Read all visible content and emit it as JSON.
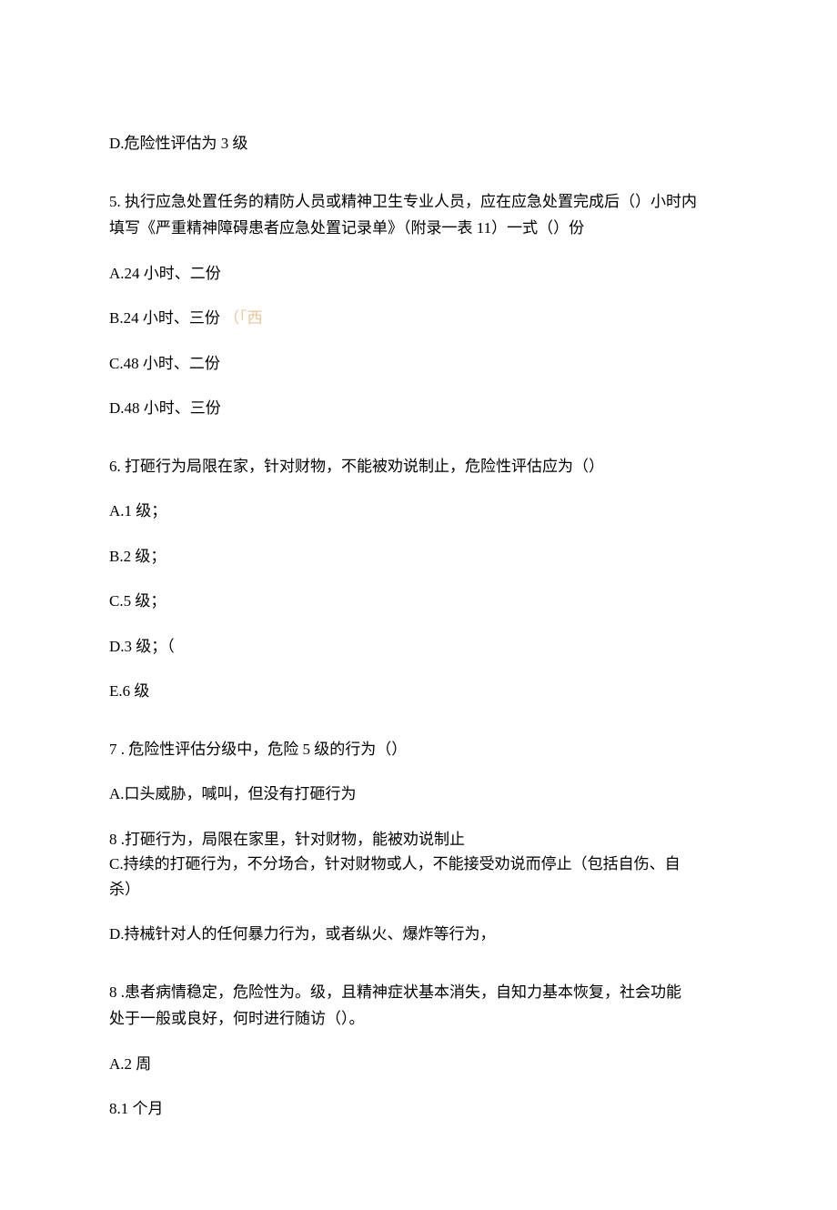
{
  "q4": {
    "D": "D.危险性评估为 3 级"
  },
  "q5": {
    "stem1": "5. 执行应急处置任务的精防人员或精神卫生专业人员，应在应急处置完成后（）小时内",
    "stem2": "填写《严重精神障碍患者应急处置记录单》（附录一表 11）一式（）份",
    "A": "A.24 小时、二份",
    "B_pre": "B.24 小时、三份",
    "B_faded": "（「西",
    "C": "C.48 小时、二份",
    "D": "D.48 小时、三份"
  },
  "q6": {
    "stem": "6. 打砸行为局限在家，针对财物，不能被劝说制止，危险性评估应为（）",
    "A": "A.1 级；",
    "B": "B.2 级；",
    "C": "C.5 级；",
    "D": "D.3 级；（",
    "E": "E.6 级"
  },
  "q7": {
    "stem": "7  . 危险性评估分级中，危险 5 级的行为（）",
    "A": "A.口头威胁，喊叫，但没有打砸行为",
    "B": "8  .打砸行为，局限在家里，针对财物，能被劝说制止",
    "C1": "C.持续的打砸行为，不分场合，针对财物或人，不能接受劝说而停止（包括自伤、自",
    "C2": "杀）",
    "D": "D.持械针对人的任何暴力行为，或者纵火、爆炸等行为，"
  },
  "q8": {
    "stem1": "8  .患者病情稳定，危险性为。级，且精神症状基本消失，自知力基本恢复，社会功能",
    "stem2": "处于一般或良好，何时进行随访（）。",
    "A": "A.2 周",
    "B": "8.1  个月"
  }
}
